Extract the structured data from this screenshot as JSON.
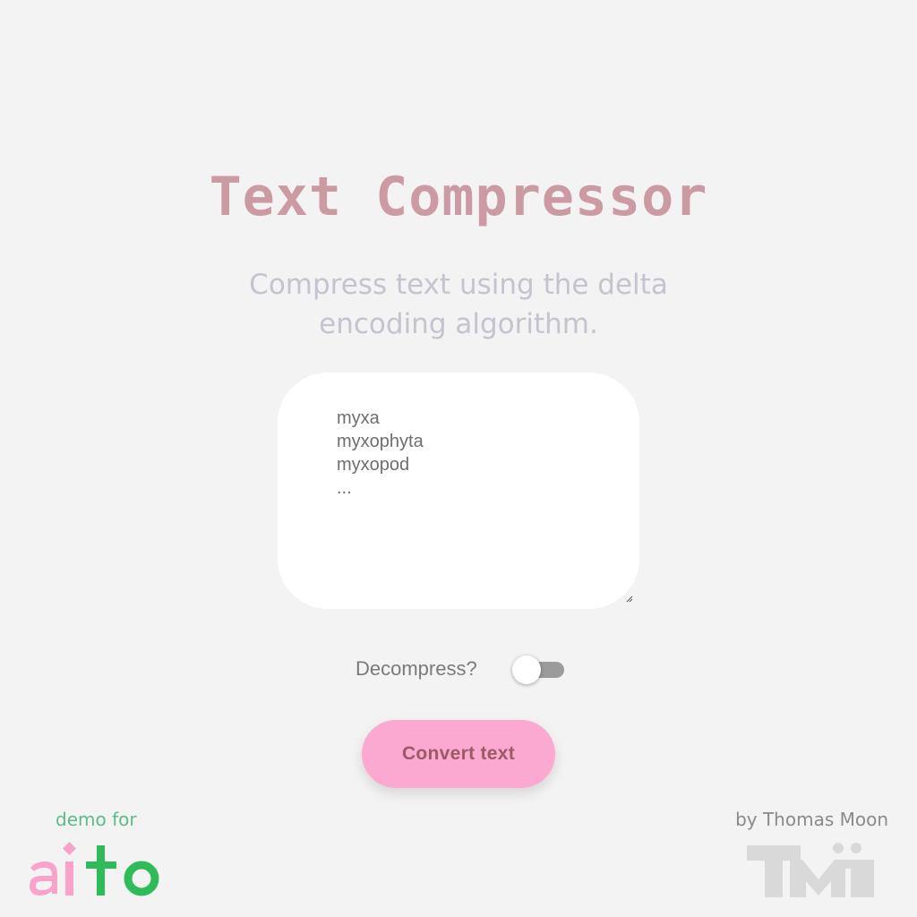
{
  "page": {
    "title": "Text Compressor",
    "subtitle": "Compress text using the delta encoding algorithm."
  },
  "input": {
    "value": "myxa\nmyxophyta\nmyxopod\n..."
  },
  "toggle": {
    "label": "Decompress?",
    "checked": false
  },
  "actions": {
    "convert_label": "Convert text"
  },
  "footer": {
    "demo_for": "demo for",
    "brand_logo_text": "aito",
    "byline": "by Thomas Moon",
    "author_logo_text": "TM"
  },
  "colors": {
    "background": "#f3f3f3",
    "title": "#cc9aa3",
    "subtitle": "#c3c4cf",
    "button": "#fba9d1",
    "button_text": "#9a5a66",
    "aito_pink": "#f9a3cc",
    "aito_green": "#2fbb5a",
    "demo_green": "#5dbb8a",
    "tm_logo": "#d9d9d9"
  }
}
